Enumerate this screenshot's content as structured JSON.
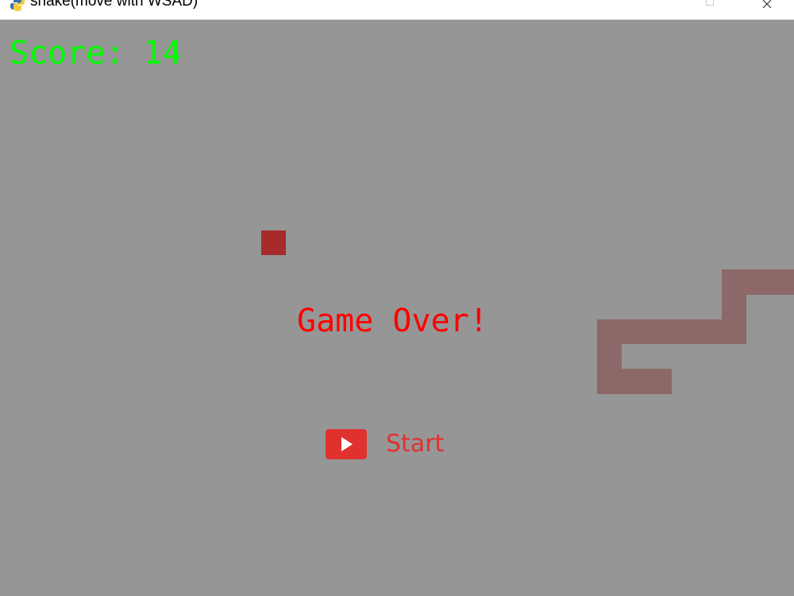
{
  "window": {
    "title": "snake(move with WSAD)",
    "icon": "python-icon",
    "controls": [
      "maximize-icon",
      "close-icon"
    ]
  },
  "game": {
    "score_text": "Score: 14",
    "game_over_text": "Game Over!",
    "start_label": "Start",
    "start_icon": "play-icon",
    "colors": {
      "background": "#969696",
      "score": "#00ff00",
      "game_over": "#ff0000",
      "food": "#a62b2b",
      "snake": "#8d6868",
      "start_button": "#e0312f"
    }
  }
}
